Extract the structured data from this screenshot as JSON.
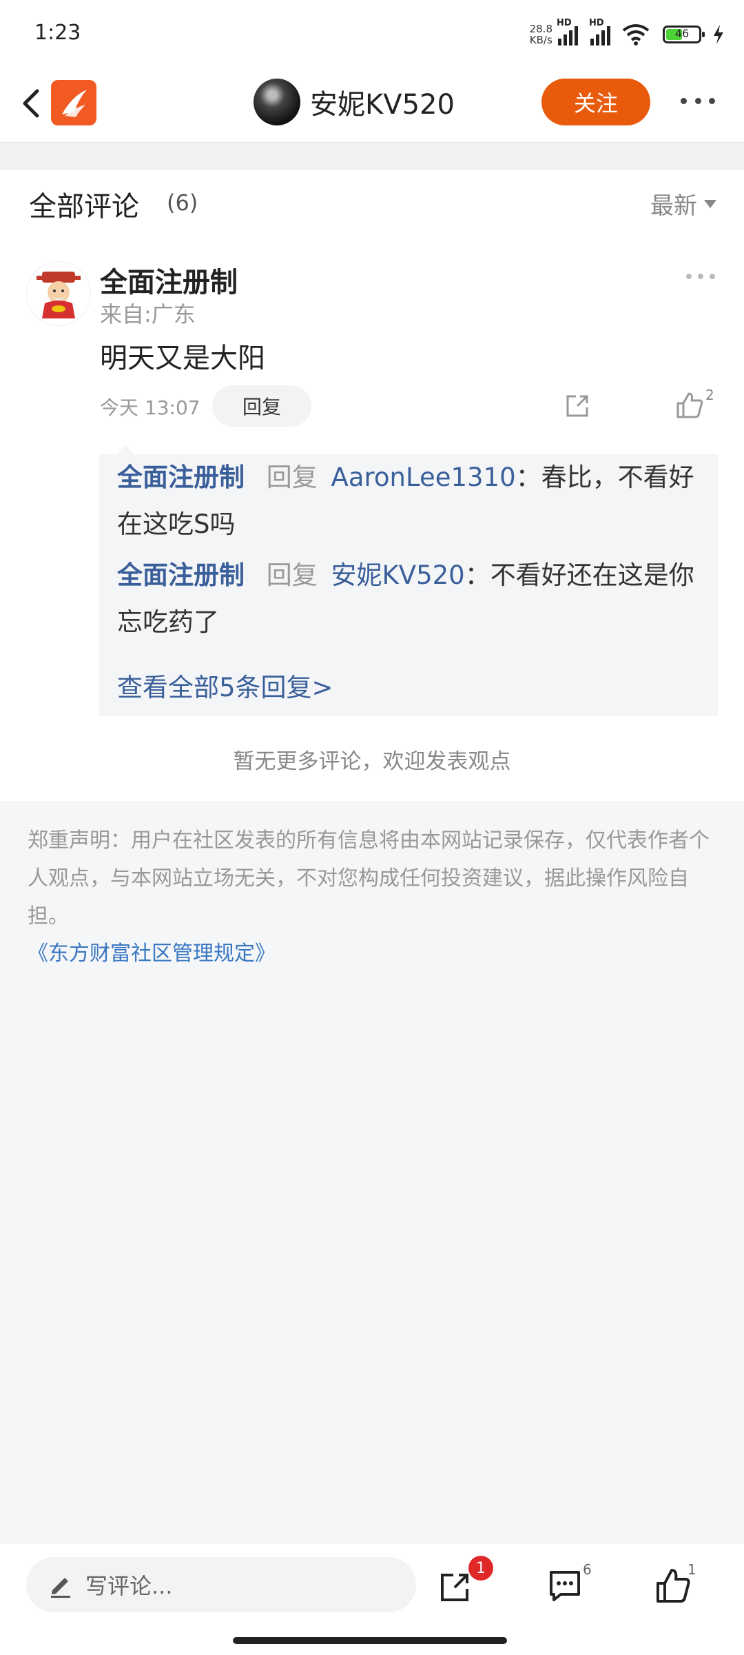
{
  "status_bar": {
    "time": "1:23",
    "speed_value": "28.8",
    "speed_unit": "KB/s",
    "battery": "46"
  },
  "header": {
    "username": "安妮KV520",
    "follow_label": "关注"
  },
  "comments": {
    "title": "全部评论",
    "count": "(6)",
    "sort_label": "最新",
    "item": {
      "author": "全面注册制",
      "from": "来自:广东",
      "text": "明天又是大阳",
      "time": "今天  13:07",
      "reply_label": "回复",
      "like_count": "2",
      "replies": [
        {
          "from": "全面注册制",
          "verb": "回复",
          "to": "AaronLee1310",
          "text": "：春比，不看好在这吃S吗"
        },
        {
          "from": "全面注册制",
          "verb": "回复",
          "to": "安妮KV520",
          "text": "：不看好还在这是你忘吃药了"
        }
      ],
      "view_all": "查看全部5条回复>"
    },
    "no_more": "暂无更多评论，欢迎发表观点"
  },
  "disclaimer": {
    "text": "郑重声明：用户在社区发表的所有信息将由本网站记录保存，仅代表作者个人观点，与本网站立场无关，不对您构成任何投资建议，据此操作风险自担。",
    "link": "《东方财富社区管理规定》"
  },
  "bottom_bar": {
    "placeholder": "写评论...",
    "share_badge": "1",
    "comment_count": "6",
    "like_count": "1"
  },
  "colors": {
    "accent": "#e85a0c",
    "link": "#3a5f9a",
    "badge": "#e02828"
  }
}
